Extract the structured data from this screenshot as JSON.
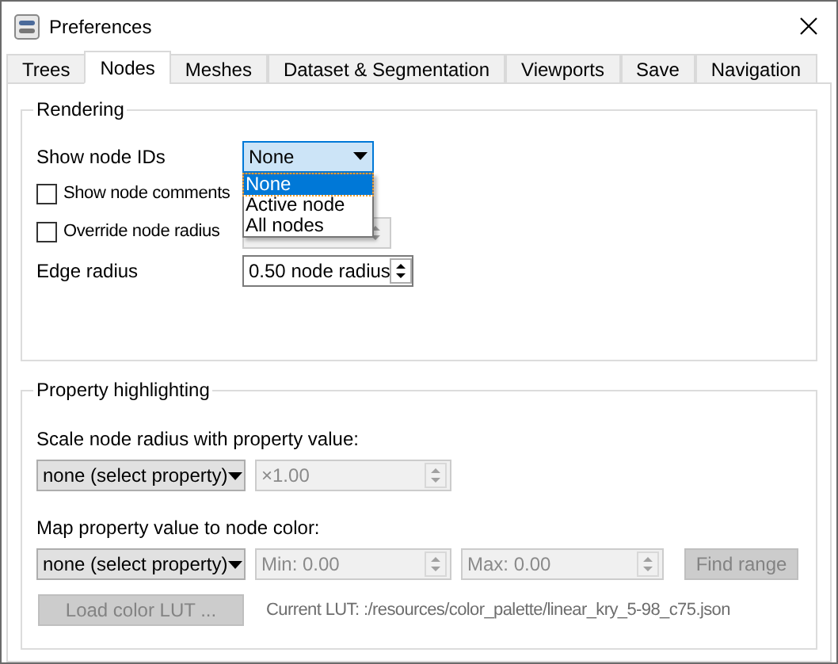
{
  "window": {
    "title": "Preferences"
  },
  "tabs": [
    {
      "label": "Trees",
      "selected": false
    },
    {
      "label": "Nodes",
      "selected": true
    },
    {
      "label": "Meshes",
      "selected": false
    },
    {
      "label": "Dataset & Segmentation",
      "selected": false
    },
    {
      "label": "Viewports",
      "selected": false
    },
    {
      "label": "Save",
      "selected": false
    },
    {
      "label": "Navigation",
      "selected": false
    }
  ],
  "rendering": {
    "title": "Rendering",
    "show_node_ids": {
      "label": "Show node IDs",
      "value": "None",
      "expanded": true,
      "options": [
        {
          "label": "None",
          "selected": true
        },
        {
          "label": "Active node",
          "selected": false
        },
        {
          "label": "All nodes",
          "selected": false
        }
      ]
    },
    "checkboxes": [
      {
        "label": "Show node comments",
        "checked": false
      },
      {
        "label": "Override node radius",
        "checked": false
      }
    ],
    "edge_radius": {
      "label": "Edge radius",
      "value": "0.50 node radius"
    }
  },
  "property_highlighting": {
    "title": "Property highlighting",
    "scale_label": "Scale node radius with property value:",
    "scale_property": {
      "value": "none (select property)"
    },
    "scale_factor": {
      "value": "×1.00",
      "disabled": true
    },
    "map_label": "Map property value to node color:",
    "color_property": {
      "value": "none (select property)"
    },
    "min": {
      "value": "Min: 0.00",
      "disabled": true
    },
    "max": {
      "value": "Max: 0.00",
      "disabled": true
    },
    "find_range": {
      "label": "Find range",
      "disabled": true
    },
    "load_lut": {
      "label": "Load color LUT ...",
      "disabled": true
    },
    "current_lut": "Current LUT: :/resources/color_palette/linear_kry_5-98_c75.json"
  }
}
